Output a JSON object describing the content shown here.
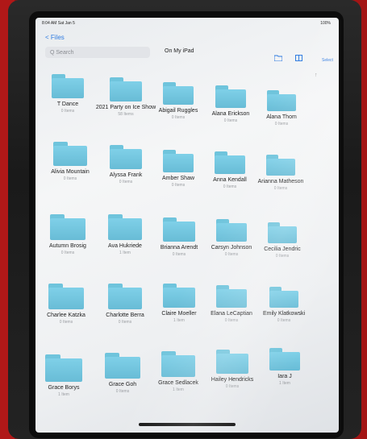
{
  "status": {
    "time": "8:04 AM   Sat Jan 5",
    "battery": "100%"
  },
  "nav": {
    "back_label": "< Files",
    "title": "On My iPad",
    "select_label": "Select"
  },
  "search": {
    "placeholder": "Q Search"
  },
  "icons": {
    "new_folder": "folder-plus-icon",
    "view": "grid-view-icon",
    "sort": "sort-arrow-icon"
  },
  "colors": {
    "folder": "#7fd0e8",
    "accent": "#2f7be0",
    "case_red": "#b01818"
  },
  "folders": [
    {
      "name": "T Dance",
      "count": "0 Items"
    },
    {
      "name": "2021 Party on Ice Show",
      "count": "58 Items"
    },
    {
      "name": "Abigail Ruggles",
      "count": "0 Items"
    },
    {
      "name": "Alana Erickson",
      "count": "0 Items"
    },
    {
      "name": "Alana Thom",
      "count": "0 Items"
    },
    {
      "name": "Alivia Mountain",
      "count": "0 Items"
    },
    {
      "name": "Alyssa Frank",
      "count": "0 Items"
    },
    {
      "name": "Amber Shaw",
      "count": "0 Items"
    },
    {
      "name": "Anna Kendall",
      "count": "0 Items"
    },
    {
      "name": "Arianna Matheson",
      "count": "0 Items"
    },
    {
      "name": "Autumn Brosig",
      "count": "0 Items"
    },
    {
      "name": "Ava Hukriede",
      "count": "1 Item"
    },
    {
      "name": "Brianna Arendt",
      "count": "0 Items"
    },
    {
      "name": "Carsyn Johnson",
      "count": "0 Items"
    },
    {
      "name": "Cecilia Jendric",
      "count": "0 Items"
    },
    {
      "name": "Charlee Katzka",
      "count": "0 Items"
    },
    {
      "name": "Charlotte Berra",
      "count": "0 Items"
    },
    {
      "name": "Claire Moeller",
      "count": "1 Item"
    },
    {
      "name": "Elana LeCaptian",
      "count": "0 Items"
    },
    {
      "name": "Emily Klatkowski",
      "count": "0 Items"
    },
    {
      "name": "Grace Borys",
      "count": "1 Item"
    },
    {
      "name": "Grace Goh",
      "count": "0 Items"
    },
    {
      "name": "Grace Sedlacek",
      "count": "1 Item"
    },
    {
      "name": "Hailey Hendricks",
      "count": "0 Items"
    },
    {
      "name": "Iara J",
      "count": "1 Item"
    }
  ]
}
